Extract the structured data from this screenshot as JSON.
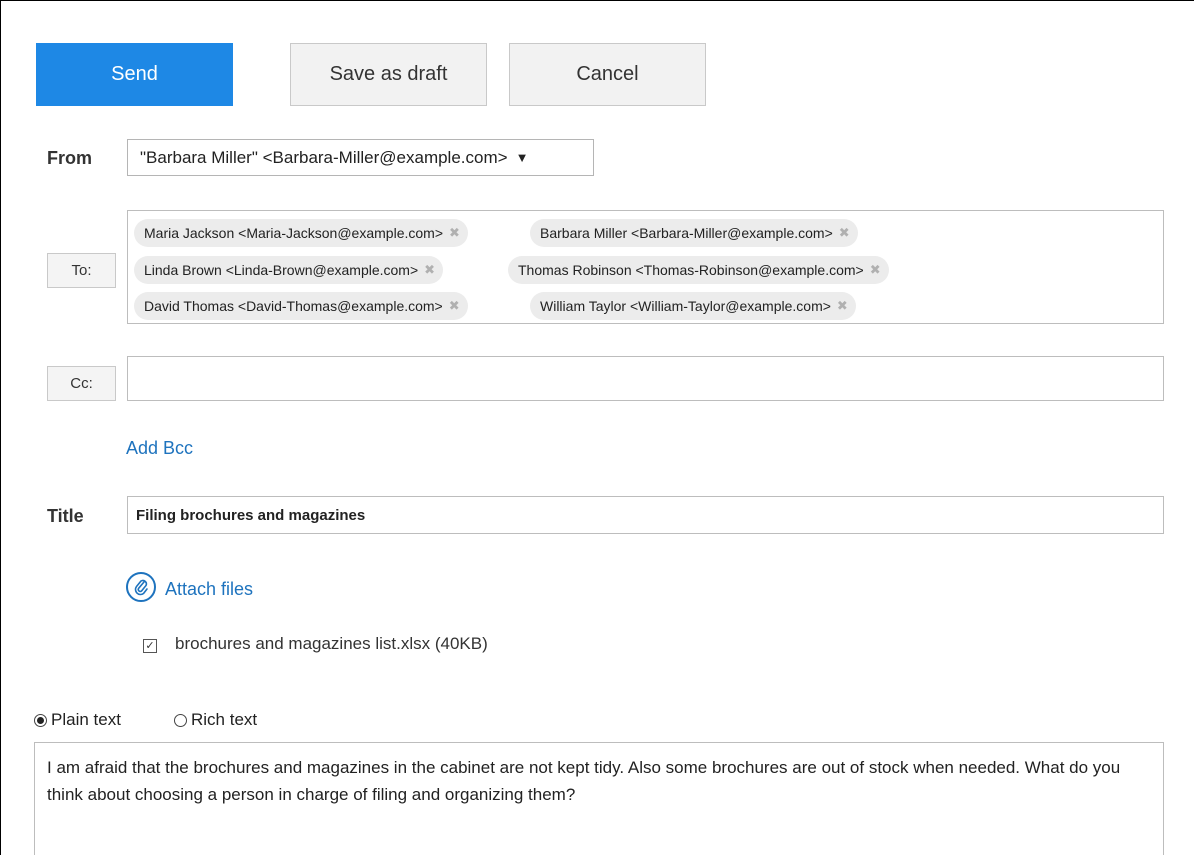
{
  "toolbar": {
    "send_label": "Send",
    "save_draft_label": "Save as draft",
    "cancel_label": "Cancel"
  },
  "from": {
    "label": "From",
    "value": "\"Barbara Miller\" <Barbara-Miller@example.com>"
  },
  "to": {
    "button_label": "To:",
    "recipients": [
      "Maria Jackson <Maria-Jackson@example.com>",
      "Barbara Miller <Barbara-Miller@example.com>",
      "Linda Brown <Linda-Brown@example.com>",
      "Thomas Robinson <Thomas-Robinson@example.com>",
      "David Thomas <David-Thomas@example.com>",
      "William Taylor <William-Taylor@example.com>"
    ]
  },
  "cc": {
    "button_label": "Cc:",
    "value": ""
  },
  "add_bcc_label": "Add Bcc",
  "title": {
    "label": "Title",
    "value": "Filing brochures and magazines"
  },
  "attach": {
    "label": "Attach files",
    "files": [
      {
        "name": "brochures and magazines list.xlsx (40KB)",
        "checked": true
      }
    ]
  },
  "format": {
    "plain_label": "Plain text",
    "rich_label": "Rich text",
    "selected": "plain"
  },
  "body_text": "I am afraid that the brochures and magazines in the cabinet are not kept tidy. Also some brochures are out of stock when needed. What do you think about choosing a person in charge of filing and organizing them?",
  "colors": {
    "accent": "#1e88e5",
    "link": "#1e73be"
  }
}
